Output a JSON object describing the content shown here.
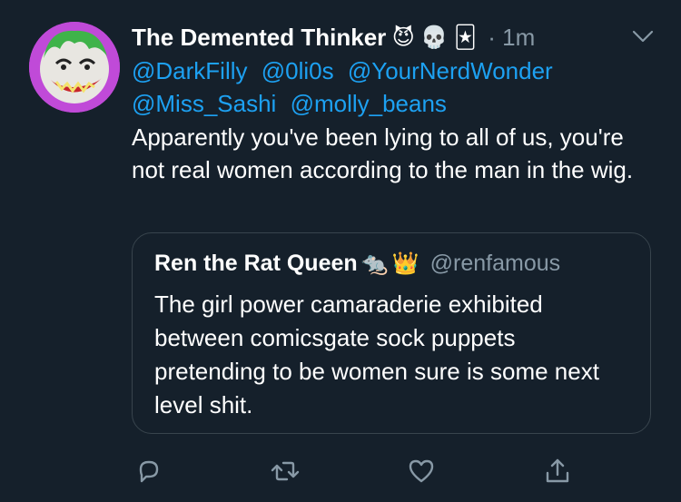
{
  "tweet": {
    "display_name": "The Demented Thinker",
    "name_emojis": [
      "😈",
      "💀",
      "🃏"
    ],
    "timestamp": "· 1m",
    "mentions": [
      "@DarkFilly",
      "@0li0s",
      "@YourNerdWonder",
      "@Miss_Sashi",
      "@molly_beans"
    ],
    "text": "Apparently you've been lying to all of us, you're not real women according to the man in the wig."
  },
  "quoted_tweet": {
    "display_name": "Ren the Rat Queen",
    "name_emojis": [
      "🐀",
      "👑"
    ],
    "handle": "@renfamous",
    "text": "The girl power camaraderie exhibited between comicsgate sock puppets pretending to be women sure is some next level shit."
  },
  "icons": {
    "menu": "chevron-down-icon",
    "reply": "reply-icon",
    "retweet": "retweet-icon",
    "like": "heart-icon",
    "share": "share-icon"
  },
  "colors": {
    "background": "#15202b",
    "link": "#1da1f2",
    "secondary_text": "#8899a6",
    "border": "#38444d"
  }
}
